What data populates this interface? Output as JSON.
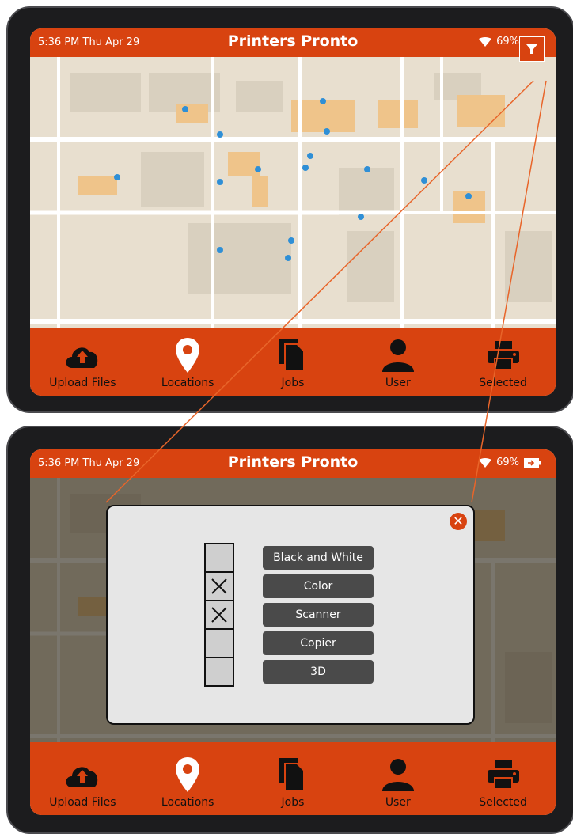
{
  "status": {
    "time": "5:36 PM   Thu Apr 29",
    "battery": "69%"
  },
  "app": {
    "title": "Printers Pronto"
  },
  "nav": [
    {
      "label": "Upload Files",
      "icon": "cloud-upload-icon"
    },
    {
      "label": "Locations",
      "icon": "location-pin-icon"
    },
    {
      "label": "Jobs",
      "icon": "documents-icon"
    },
    {
      "label": "User",
      "icon": "user-icon"
    },
    {
      "label": "Selected",
      "icon": "printer-icon"
    }
  ],
  "filter": {
    "checked": [
      false,
      true,
      true,
      false,
      false
    ],
    "options": [
      "Black and White",
      "Color",
      "Scanner",
      "Copier",
      "3D"
    ]
  },
  "colors": {
    "accent": "#d84310",
    "callout": "#e8652a",
    "pin": "#2f8fd6",
    "modal": "#e6e6e6"
  }
}
